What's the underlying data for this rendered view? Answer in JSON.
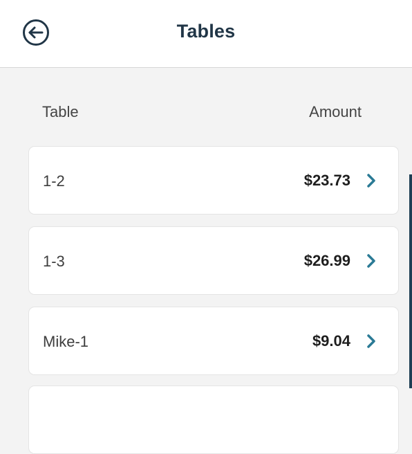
{
  "header": {
    "title": "Tables",
    "back_icon": "arrow-left-circle-icon"
  },
  "columns": {
    "table": "Table",
    "amount": "Amount"
  },
  "rows": [
    {
      "name": "1-2",
      "amount": "$23.73"
    },
    {
      "name": "1-3",
      "amount": "$26.99"
    },
    {
      "name": "Mike-1",
      "amount": "$9.04"
    }
  ],
  "colors": {
    "accent": "#2a7a95",
    "title": "#213647",
    "background": "#f3f3f3"
  }
}
